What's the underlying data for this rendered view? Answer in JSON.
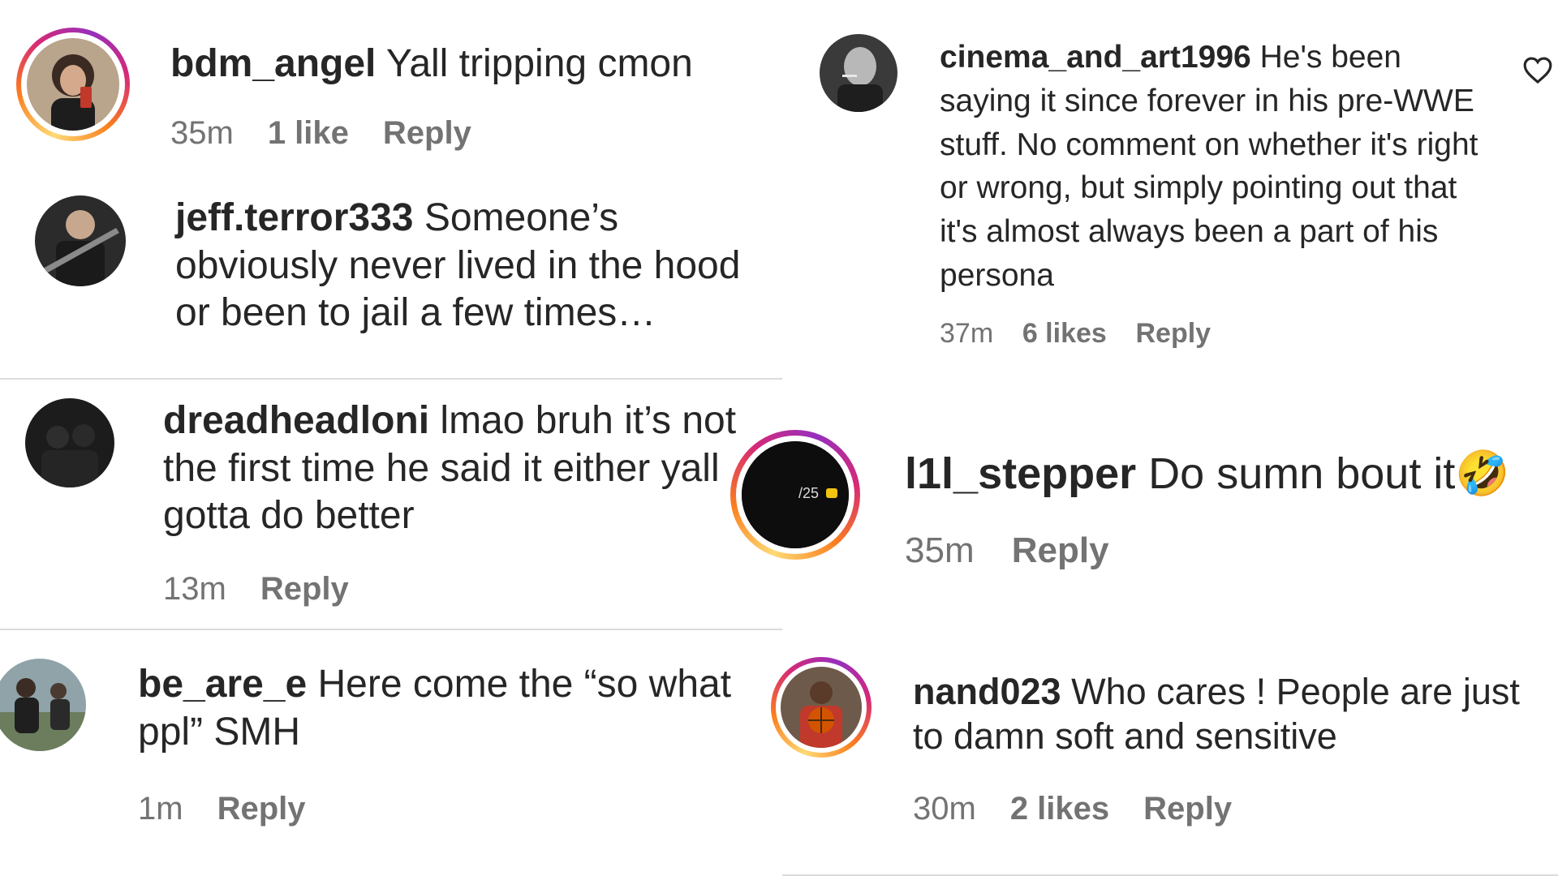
{
  "comments": [
    {
      "username": "bdm_angel",
      "text": "Yall tripping cmon",
      "time": "35m",
      "likes": "1 like",
      "reply": "Reply",
      "avatar_icon": "profile-photo-selfie"
    },
    {
      "username": "jeff.terror333",
      "text": "Someone’s obviously never lived in the hood or been to jail a few times…",
      "avatar_icon": "profile-photo-guitarist"
    },
    {
      "username": "dreadheadloni",
      "text": "lmao bruh it’s not the first time he said it either yall gotta do better",
      "time": "13m",
      "reply": "Reply",
      "avatar_icon": "profile-photo-dark"
    },
    {
      "username": "be_are_e",
      "text": "Here come the “so what ppl” SMH",
      "time": "1m",
      "reply": "Reply",
      "avatar_icon": "profile-photo-outdoor"
    },
    {
      "username": "cinema_and_art1996",
      "text": "He's been saying it since forever in his pre-WWE stuff. No comment on whether it's right or wrong, but simply pointing out that it's almost always been a part of his persona",
      "time": "37m",
      "likes": "6 likes",
      "reply": "Reply",
      "avatar_icon": "profile-photo-man-smoking"
    },
    {
      "username": "l1l_stepper",
      "text": "Do sumn bout it🤣",
      "time": "35m",
      "reply": "Reply",
      "avatar_icon": "profile-photo-phone-screen",
      "avatar_overlay": "/25"
    },
    {
      "username": "nand023",
      "text": "Who cares ! People are just to damn soft and sensitive",
      "time": "30m",
      "likes": "2 likes",
      "reply": "Reply",
      "avatar_icon": "profile-photo-basketball"
    }
  ],
  "icons": {
    "like": "heart-outline-icon"
  },
  "colors": {
    "meta_gray": "#737373",
    "text": "#262626",
    "divider": "#dbdbdb",
    "ring_start": "#feda75",
    "ring_mid": "#d62976",
    "ring_end": "#962fbf"
  }
}
